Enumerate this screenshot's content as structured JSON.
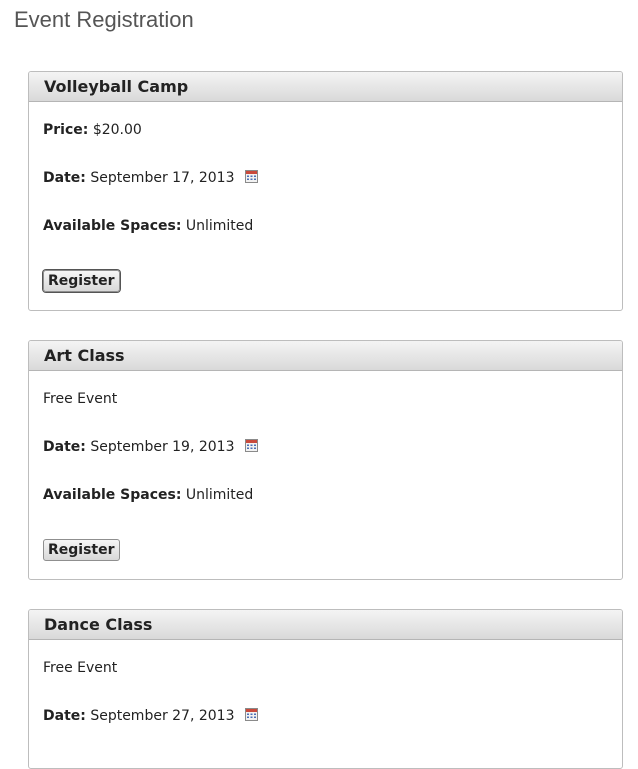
{
  "page": {
    "title": "Event Registration"
  },
  "events": [
    {
      "name": "Volleyball Camp",
      "price_label": "Price:",
      "price_value": "$20.00",
      "date_label": "Date:",
      "date_value": "September 17, 2013",
      "spaces_label": "Available Spaces:",
      "spaces_value": "Unlimited",
      "button_label": "Register"
    },
    {
      "name": "Art Class",
      "price_text": "Free Event",
      "date_label": "Date:",
      "date_value": "September 19, 2013",
      "spaces_label": "Available Spaces:",
      "spaces_value": "Unlimited",
      "button_label": "Register"
    },
    {
      "name": "Dance Class",
      "price_text": "Free Event",
      "date_label": "Date:",
      "date_value": "September 27, 2013"
    }
  ],
  "icons": {
    "calendar": "calendar-icon"
  },
  "colors": {
    "title": "#555555",
    "header_gradient_top": "#f4f4f4",
    "header_gradient_bottom": "#d9d9d9",
    "card_border": "#bdbdbd"
  }
}
